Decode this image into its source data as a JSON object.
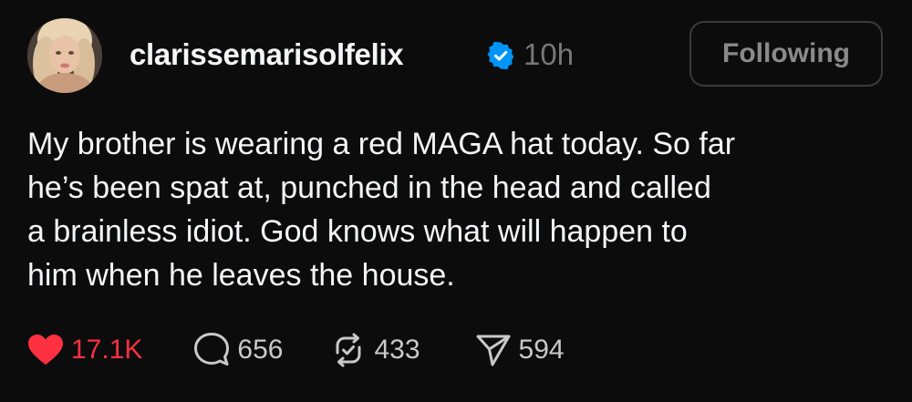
{
  "post": {
    "username": "clarissemarisolfelix",
    "timestamp": "10h",
    "follow_button": "Following",
    "text": "My brother is wearing a red MAGA hat today. So far\nhe’s been spat at, punched in the head and called\na brainless idiot. God knows what will happen to\nhim when he leaves the house."
  },
  "actions": {
    "like": {
      "icon": "heart-filled-icon",
      "count": "17.1K",
      "color": "#ff3040"
    },
    "reply": {
      "icon": "speech-bubble-icon",
      "count": "656"
    },
    "repost": {
      "icon": "repost-icon",
      "count": "433"
    },
    "share": {
      "icon": "paper-plane-icon",
      "count": "594"
    }
  },
  "colors": {
    "background": "#0c0c0c",
    "text": "#f3f5f7",
    "muted": "#777777",
    "verified": "#0095f6",
    "like": "#ff3040"
  }
}
